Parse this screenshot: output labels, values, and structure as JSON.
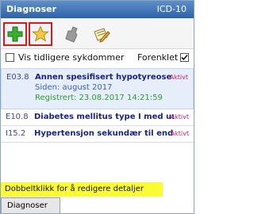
{
  "window": {
    "title": "Diagnoser",
    "code_system": "ICD-10"
  },
  "toolbar": {
    "buttons": [
      {
        "name": "add-icon"
      },
      {
        "name": "star-icon"
      },
      {
        "name": "stamp-icon"
      },
      {
        "name": "notepad-pencil-icon"
      }
    ]
  },
  "options": {
    "show_previous_label": "Vis tidligere sykdommer",
    "show_previous_checked": false,
    "simplified_label": "Forenklet",
    "simplified_checked": true
  },
  "diagnoses": [
    {
      "code": "E03.8",
      "name": "Annen spesifisert hypotyreose",
      "status": "Aktivt",
      "since": "Siden: august 2017",
      "registered": "Registrert: 23.08.2017 14:21:59"
    },
    {
      "code": "E10.8",
      "name": "Diabetes mellitus type I med us...",
      "status": "Aktivt"
    },
    {
      "code": "I15.2",
      "name": "Hypertensjon sekundær til end...",
      "status": "Aktivt"
    }
  ],
  "hint": "Dobbeltklikk for å redigere detaljer",
  "tabs": [
    "Diagnoser"
  ],
  "colors": {
    "title_bar": "#2c62a8",
    "highlight_border": "#d9191a",
    "status": "#c0206a",
    "registered": "#2f9a33",
    "hint_bg": "#fbfb33"
  }
}
